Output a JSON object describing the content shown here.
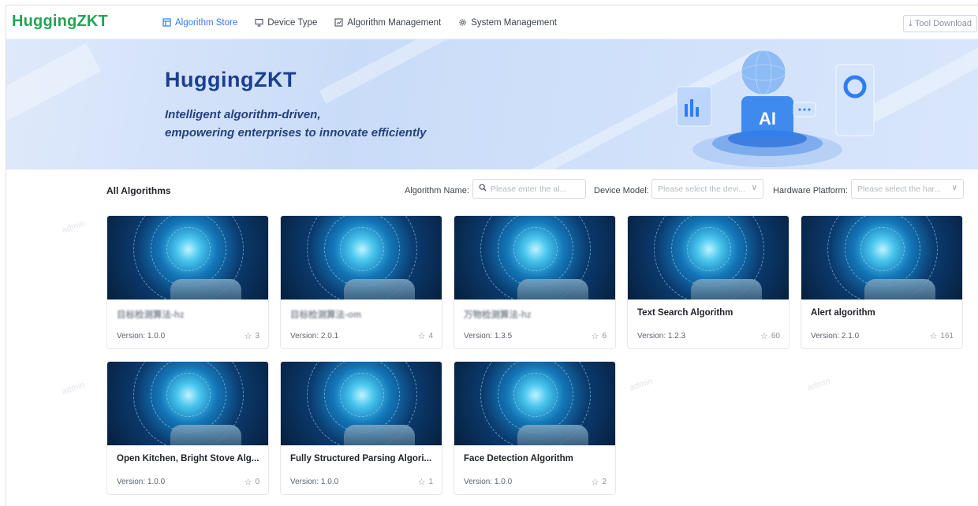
{
  "app": {
    "logo": "HuggingZKT"
  },
  "nav": [
    {
      "label": "Algorithm Store",
      "icon": "store-icon",
      "active": true
    },
    {
      "label": "Device Type",
      "icon": "monitor-icon",
      "active": false
    },
    {
      "label": "Algorithm Management",
      "icon": "chart-icon",
      "active": false
    },
    {
      "label": "System Management",
      "icon": "gear-icon",
      "active": false
    }
  ],
  "tool_button": {
    "label": "Tool Download",
    "icon": "download-icon"
  },
  "banner": {
    "title": "HuggingZKT",
    "subtitle_line1": "Intelligent algorithm-driven,",
    "subtitle_line2": "empowering enterprises to innovate efficiently",
    "art_label": "AI"
  },
  "filters": {
    "section_title": "All Algorithms",
    "algorithm_name_label": "Algorithm Name:",
    "algorithm_name_placeholder": "Please enter the al...",
    "device_model_label": "Device Model:",
    "device_model_placeholder": "Please select the devi...",
    "hardware_platform_label": "Hardware Platform:",
    "hardware_platform_placeholder": "Please select the har..."
  },
  "watermark": "admin",
  "cards": [
    {
      "name": "目标检测算法-hz",
      "blurred": true,
      "version": "Version: 1.0.0",
      "stars": "3"
    },
    {
      "name": "目标检测算法-om",
      "blurred": true,
      "version": "Version: 2.0.1",
      "stars": "4"
    },
    {
      "name": "万物检测算法-hz",
      "blurred": true,
      "version": "Version: 1.3.5",
      "stars": "6"
    },
    {
      "name": "Text Search Algorithm",
      "blurred": false,
      "version": "Version: 1.2.3",
      "stars": "60"
    },
    {
      "name": "Alert algorithm",
      "blurred": false,
      "version": "Version: 2.1.0",
      "stars": "161"
    },
    {
      "name": "Open Kitchen, Bright Stove Alg...",
      "blurred": false,
      "version": "Version: 1.0.0",
      "stars": "0"
    },
    {
      "name": "Fully Structured Parsing Algori...",
      "blurred": false,
      "version": "Version: 1.0.0",
      "stars": "1"
    },
    {
      "name": "Face Detection Algorithm",
      "blurred": false,
      "version": "Version: 1.0.0",
      "stars": "2"
    }
  ]
}
